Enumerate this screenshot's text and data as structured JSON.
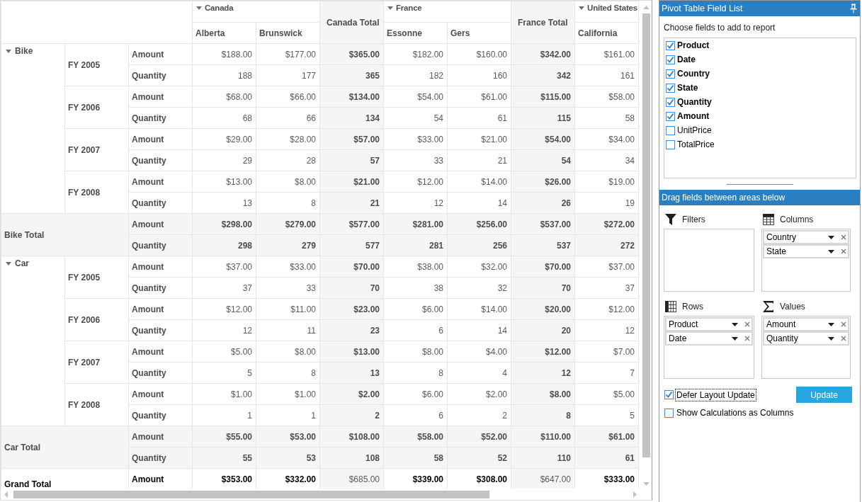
{
  "pivot_grid": {
    "column_groups": [
      {
        "label": "Canada",
        "expanded": true,
        "members": [
          "Alberta",
          "Brunswick"
        ],
        "total_label": "Canada Total"
      },
      {
        "label": "France",
        "expanded": true,
        "members": [
          "Essonne",
          "Gers"
        ],
        "total_label": "France Total"
      },
      {
        "label": "United States",
        "expanded": true,
        "members": [
          "California"
        ]
      }
    ],
    "row_groups": [
      {
        "label": "Bike",
        "expanded": true,
        "periods": [
          {
            "label": "FY 2005",
            "rows": [
              {
                "measure": "Amount",
                "cells": [
                  "$188.00",
                  "$177.00",
                  "$365.00",
                  "$182.00",
                  "$160.00",
                  "$342.00",
                  "$161.00"
                ]
              },
              {
                "measure": "Quantity",
                "cells": [
                  "188",
                  "177",
                  "365",
                  "182",
                  "160",
                  "342",
                  "161"
                ]
              }
            ]
          },
          {
            "label": "FY 2006",
            "rows": [
              {
                "measure": "Amount",
                "cells": [
                  "$68.00",
                  "$66.00",
                  "$134.00",
                  "$54.00",
                  "$61.00",
                  "$115.00",
                  "$58.00"
                ]
              },
              {
                "measure": "Quantity",
                "cells": [
                  "68",
                  "66",
                  "134",
                  "54",
                  "61",
                  "115",
                  "58"
                ]
              }
            ]
          },
          {
            "label": "FY 2007",
            "rows": [
              {
                "measure": "Amount",
                "cells": [
                  "$29.00",
                  "$28.00",
                  "$57.00",
                  "$33.00",
                  "$21.00",
                  "$54.00",
                  "$34.00"
                ]
              },
              {
                "measure": "Quantity",
                "cells": [
                  "29",
                  "28",
                  "57",
                  "33",
                  "21",
                  "54",
                  "34"
                ]
              }
            ]
          },
          {
            "label": "FY 2008",
            "rows": [
              {
                "measure": "Amount",
                "cells": [
                  "$13.00",
                  "$8.00",
                  "$21.00",
                  "$12.00",
                  "$14.00",
                  "$26.00",
                  "$19.00"
                ]
              },
              {
                "measure": "Quantity",
                "cells": [
                  "13",
                  "8",
                  "21",
                  "12",
                  "14",
                  "26",
                  "19"
                ]
              }
            ]
          }
        ],
        "total": {
          "label": "Bike Total",
          "rows": [
            {
              "measure": "Amount",
              "cells": [
                "$298.00",
                "$279.00",
                "$577.00",
                "$281.00",
                "$256.00",
                "$537.00",
                "$272.00"
              ]
            },
            {
              "measure": "Quantity",
              "cells": [
                "298",
                "279",
                "577",
                "281",
                "256",
                "537",
                "272"
              ]
            }
          ]
        }
      },
      {
        "label": "Car",
        "expanded": true,
        "periods": [
          {
            "label": "FY 2005",
            "rows": [
              {
                "measure": "Amount",
                "cells": [
                  "$37.00",
                  "$33.00",
                  "$70.00",
                  "$38.00",
                  "$32.00",
                  "$70.00",
                  "$37.00"
                ]
              },
              {
                "measure": "Quantity",
                "cells": [
                  "37",
                  "33",
                  "70",
                  "38",
                  "32",
                  "70",
                  "37"
                ]
              }
            ]
          },
          {
            "label": "FY 2006",
            "rows": [
              {
                "measure": "Amount",
                "cells": [
                  "$12.00",
                  "$11.00",
                  "$23.00",
                  "$6.00",
                  "$14.00",
                  "$20.00",
                  "$12.00"
                ]
              },
              {
                "measure": "Quantity",
                "cells": [
                  "12",
                  "11",
                  "23",
                  "6",
                  "14",
                  "20",
                  "12"
                ]
              }
            ]
          },
          {
            "label": "FY 2007",
            "rows": [
              {
                "measure": "Amount",
                "cells": [
                  "$5.00",
                  "$8.00",
                  "$13.00",
                  "$8.00",
                  "$4.00",
                  "$12.00",
                  "$7.00"
                ]
              },
              {
                "measure": "Quantity",
                "cells": [
                  "5",
                  "8",
                  "13",
                  "8",
                  "4",
                  "12",
                  "7"
                ]
              }
            ]
          },
          {
            "label": "FY 2008",
            "rows": [
              {
                "measure": "Amount",
                "cells": [
                  "$1.00",
                  "$1.00",
                  "$2.00",
                  "$6.00",
                  "$2.00",
                  "$8.00",
                  "$5.00"
                ]
              },
              {
                "measure": "Quantity",
                "cells": [
                  "1",
                  "1",
                  "2",
                  "6",
                  "2",
                  "8",
                  "5"
                ]
              }
            ]
          }
        ],
        "total": {
          "label": "Car Total",
          "rows": [
            {
              "measure": "Amount",
              "cells": [
                "$55.00",
                "$53.00",
                "$108.00",
                "$58.00",
                "$52.00",
                "$110.00",
                "$61.00"
              ]
            },
            {
              "measure": "Quantity",
              "cells": [
                "55",
                "53",
                "108",
                "58",
                "52",
                "110",
                "61"
              ]
            }
          ]
        }
      }
    ],
    "grand_total": {
      "label": "Grand Total",
      "rows": [
        {
          "measure": "Amount",
          "cells": [
            "$353.00",
            "$332.00",
            "$685.00",
            "$339.00",
            "$308.00",
            "$647.00",
            "$333.00"
          ]
        }
      ]
    }
  },
  "field_list": {
    "title": "Pivot Table Field List",
    "instruction": "Choose fields to add to report",
    "fields": [
      {
        "label": "Product",
        "checked": true
      },
      {
        "label": "Date",
        "checked": true
      },
      {
        "label": "Country",
        "checked": true
      },
      {
        "label": "State",
        "checked": true
      },
      {
        "label": "Quantity",
        "checked": true
      },
      {
        "label": "Amount",
        "checked": true
      },
      {
        "label": "UnitPrice",
        "checked": false
      },
      {
        "label": "TotalPrice",
        "checked": false
      }
    ],
    "areas_header": "Drag fields between areas below",
    "areas": [
      {
        "kind": "filters",
        "label": "Filters"
      },
      {
        "kind": "columns",
        "label": "Columns",
        "items": [
          "Country",
          "State"
        ]
      },
      {
        "kind": "rows",
        "label": "Rows",
        "items": [
          "Product",
          "Date"
        ]
      },
      {
        "kind": "values",
        "label": "Values",
        "items": [
          "Amount",
          "Quantity"
        ]
      }
    ],
    "options": [
      {
        "label": "Defer Layout Update",
        "checked": true,
        "focused": true
      },
      {
        "label": "Show Calculations as Columns",
        "checked": false,
        "focused": false
      }
    ],
    "update_button": "Update"
  }
}
